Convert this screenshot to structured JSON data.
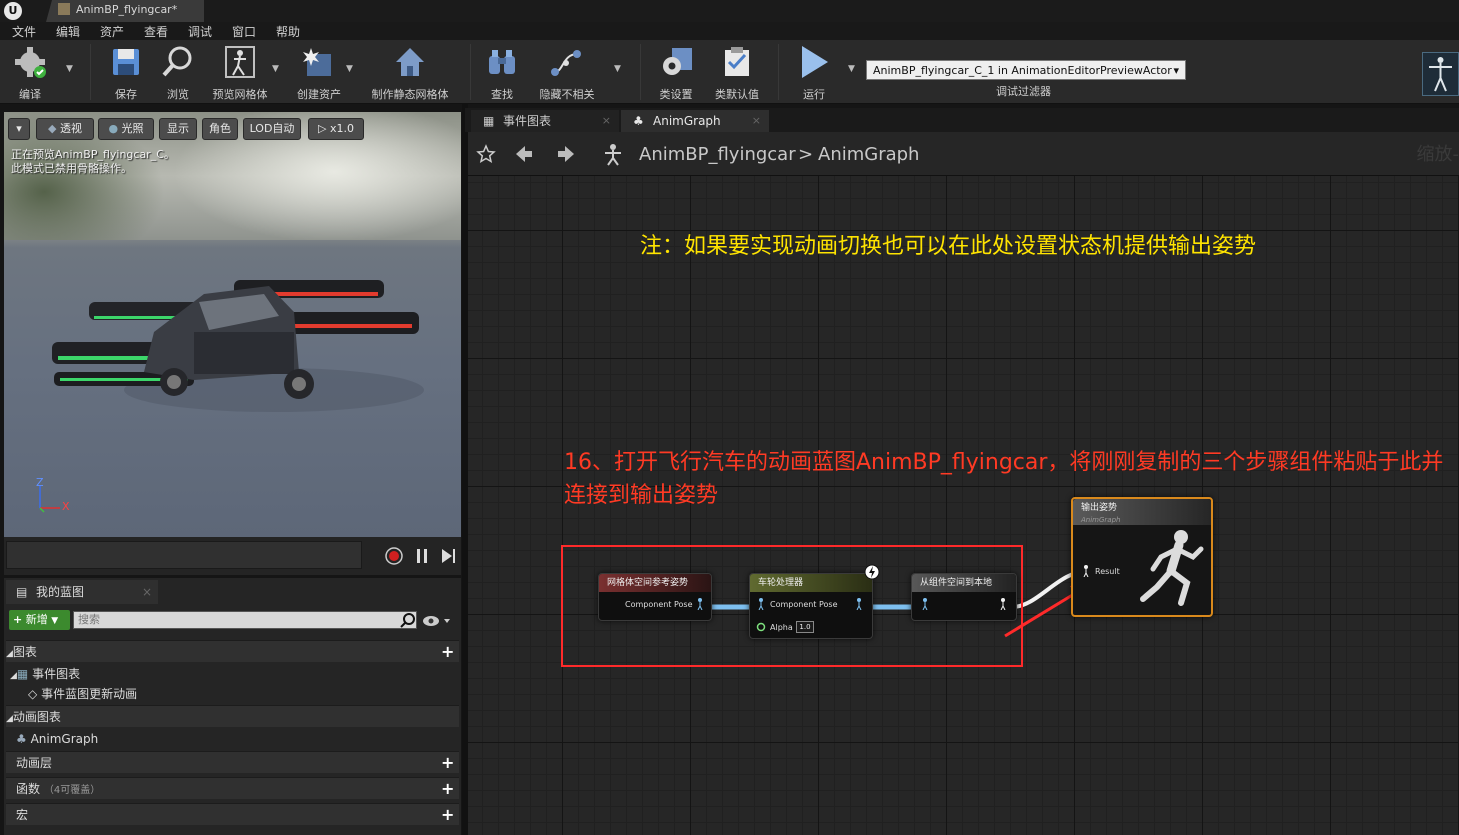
{
  "window": {
    "doc_tab": "AnimBP_flyingcar*"
  },
  "menu": [
    "文件",
    "编辑",
    "资产",
    "查看",
    "调试",
    "窗口",
    "帮助"
  ],
  "toolbar": {
    "buttons": [
      "编译",
      "保存",
      "浏览",
      "预览网格体",
      "创建资产",
      "制作静态网格体",
      "查找",
      "隐藏不相关",
      "类设置",
      "类默认值",
      "运行"
    ],
    "debug_object": "AnimBP_flyingcar_C_1 in AnimationEditorPreviewActor",
    "debug_filter": "调试过滤器"
  },
  "viewport": {
    "buttons": [
      "透视",
      "光照",
      "显示",
      "角色",
      "LOD自动",
      "x1.0"
    ],
    "message_line1": "正在预览AnimBP_flyingcar_C。",
    "message_line2": "此模式已禁用骨骼操作。",
    "axis_z": "Z",
    "axis_x": "X"
  },
  "my_blueprint": {
    "tab_label": "我的蓝图",
    "new_button": "新增",
    "search_placeholder": "搜索",
    "graphs_section": "图表",
    "event_graph": "事件图表",
    "event_graph_child": "事件蓝图更新动画",
    "anim_graphs_section": "动画图表",
    "anim_graph_item": "AnimGraph",
    "anim_layers": "动画层",
    "functions": "函数",
    "functions_sub": "（4可覆盖）",
    "macros": "宏"
  },
  "graph_tabs": [
    "事件图表",
    "AnimGraph"
  ],
  "graph_nav": {
    "crumb_bp": "AnimBP_flyingcar",
    "crumb_sep": ">",
    "crumb_graph": "AnimGraph",
    "zoom": "缩放-"
  },
  "annotations": {
    "yellow_note": "注：如果要实现动画切换也可以在此处设置状态机提供输出姿势",
    "red_note": "16、打开飞行汽车的动画蓝图AnimBP_flyingcar，将刚刚复制的三个步骤组件粘贴于此并连接到输出姿势"
  },
  "nodes": {
    "ref_pose": {
      "title": "网格体空间参考姿势",
      "pin": "Component Pose"
    },
    "wheel": {
      "title": "车轮处理器",
      "pin": "Component Pose",
      "alpha_label": "Alpha",
      "alpha_value": "1.0"
    },
    "convert": {
      "title": "从组件空间到本地"
    },
    "output": {
      "title": "输出姿势",
      "subtitle": "AnimGraph",
      "pin": "Result"
    }
  },
  "colors": {
    "yellow": "#ffe400",
    "red": "#ff3a24",
    "accent_green": "#3c8a2e",
    "output_border": "#d9891c"
  }
}
